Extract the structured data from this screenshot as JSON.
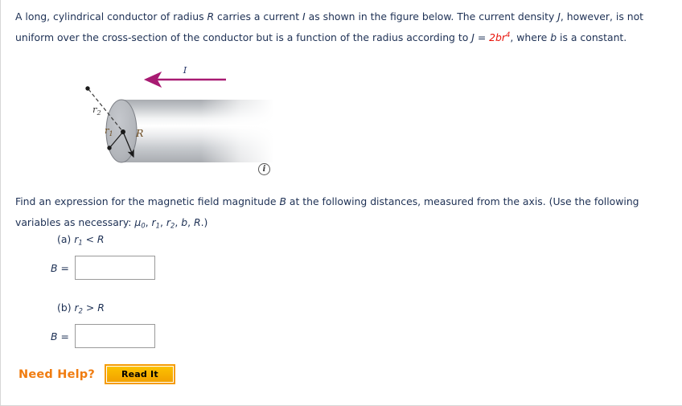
{
  "problem": {
    "line1_a": "A long, cylindrical conductor of radius ",
    "var_R": "R",
    "line1_b": " carries a current ",
    "var_I": "I",
    "line1_c": " as shown in the figure below. The current density ",
    "var_J": "J",
    "line1_d": ", however, is",
    "line2_a": "not uniform over the cross-section of the conductor but is a function of the radius according to ",
    "eq_J": "J",
    "eq_equals": " = ",
    "eq_rhs": "2br",
    "eq_exp": "4",
    "line2_b": ", where ",
    "var_b": "b",
    "line2_c": " is a",
    "line3": "constant."
  },
  "figure": {
    "current_label": "I",
    "radius_r2_label": "r",
    "radius_r2_sub": "2",
    "radius_r1_label": "r",
    "radius_r1_sub": "1",
    "radius_R_label": "R",
    "info_icon_glyph": "i",
    "arrow_color": "#a81b72",
    "cylinder_fill": "#b5b8bd",
    "label_color": "#3c3c3c"
  },
  "question": {
    "intro_a": "Find an expression for the magnetic field magnitude ",
    "intro_B": "B",
    "intro_b": " at the following distances, measured from the axis. (Use the",
    "intro_c": "following variables as necessary: ",
    "vars_mu": "μ",
    "vars_mu_sub": "0",
    "vars_sep1": ", ",
    "vars_r1": "r",
    "vars_r1_sub": "1",
    "vars_sep2": ", ",
    "vars_r2": "r",
    "vars_r2_sub": "2",
    "vars_sep3": ", ",
    "vars_b": "b",
    "vars_sep4": ", ",
    "vars_R": "R",
    "vars_end": ".)"
  },
  "parts": [
    {
      "prefix": "(a) ",
      "var": "r",
      "sub": "1",
      "relation": " < ",
      "bound": "R",
      "answer_label": "B =",
      "answer_value": "",
      "answer_placeholder": ""
    },
    {
      "prefix": "(b) ",
      "var": "r",
      "sub": "2",
      "relation": " > ",
      "bound": "R",
      "answer_label": "B =",
      "answer_value": "",
      "answer_placeholder": ""
    }
  ],
  "help": {
    "need_help_label": "Need Help?",
    "read_it_label": "Read It",
    "accent_color": "#f07c10",
    "button_color": "#f2a100"
  }
}
